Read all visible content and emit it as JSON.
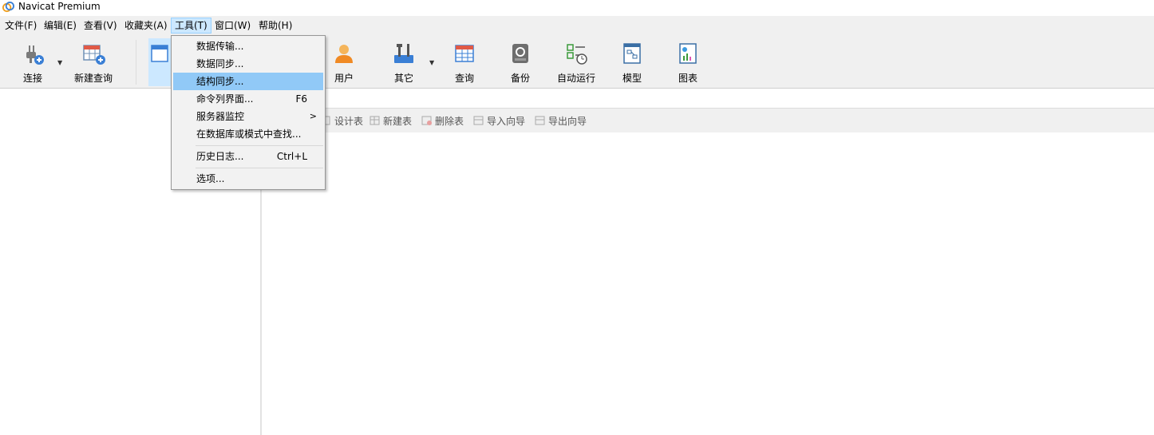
{
  "window": {
    "title": "Navicat Premium"
  },
  "menubar": {
    "items": [
      {
        "label": "文件(F)"
      },
      {
        "label": "编辑(E)"
      },
      {
        "label": "查看(V)"
      },
      {
        "label": "收藏夹(A)"
      },
      {
        "label": "工具(T)"
      },
      {
        "label": "窗口(W)"
      },
      {
        "label": "帮助(H)"
      }
    ],
    "active_index": 4
  },
  "toolbar": {
    "buttons": [
      {
        "label": "连接",
        "icon": "plug-icon"
      },
      {
        "label": "新建查询",
        "icon": "new-query-icon"
      },
      {
        "label": "",
        "icon": "table-icon"
      },
      {
        "label": "用户",
        "icon": "user-icon"
      },
      {
        "label": "其它",
        "icon": "tools-icon"
      },
      {
        "label": "查询",
        "icon": "query-icon"
      },
      {
        "label": "备份",
        "icon": "backup-icon"
      },
      {
        "label": "自动运行",
        "icon": "schedule-icon"
      },
      {
        "label": "模型",
        "icon": "model-icon"
      },
      {
        "label": "图表",
        "icon": "chart-icon"
      }
    ]
  },
  "object_toolbar": {
    "buttons": [
      {
        "label": "设计表",
        "icon": "design-table-icon"
      },
      {
        "label": "新建表",
        "icon": "new-table-icon"
      },
      {
        "label": "删除表",
        "icon": "delete-table-icon"
      },
      {
        "label": "导入向导",
        "icon": "import-wizard-icon"
      },
      {
        "label": "导出向导",
        "icon": "export-wizard-icon"
      }
    ]
  },
  "tools_menu": {
    "items": [
      {
        "label": "数据传输..."
      },
      {
        "label": "数据同步..."
      },
      {
        "label": "结构同步...",
        "highlighted": true
      },
      {
        "label": "命令列界面...",
        "shortcut": "F6"
      },
      {
        "label": "服务器监控",
        "submenu_indicator": ">"
      },
      {
        "label": "在数据库或模式中查找..."
      },
      {
        "label": "历史日志...",
        "shortcut": "Ctrl+L"
      },
      {
        "label": "选项..."
      }
    ]
  },
  "colors": {
    "menubar_bg": "#f0f0f0",
    "active_menu_bg": "#cce8ff",
    "menu_highlight": "#91c9f7"
  }
}
